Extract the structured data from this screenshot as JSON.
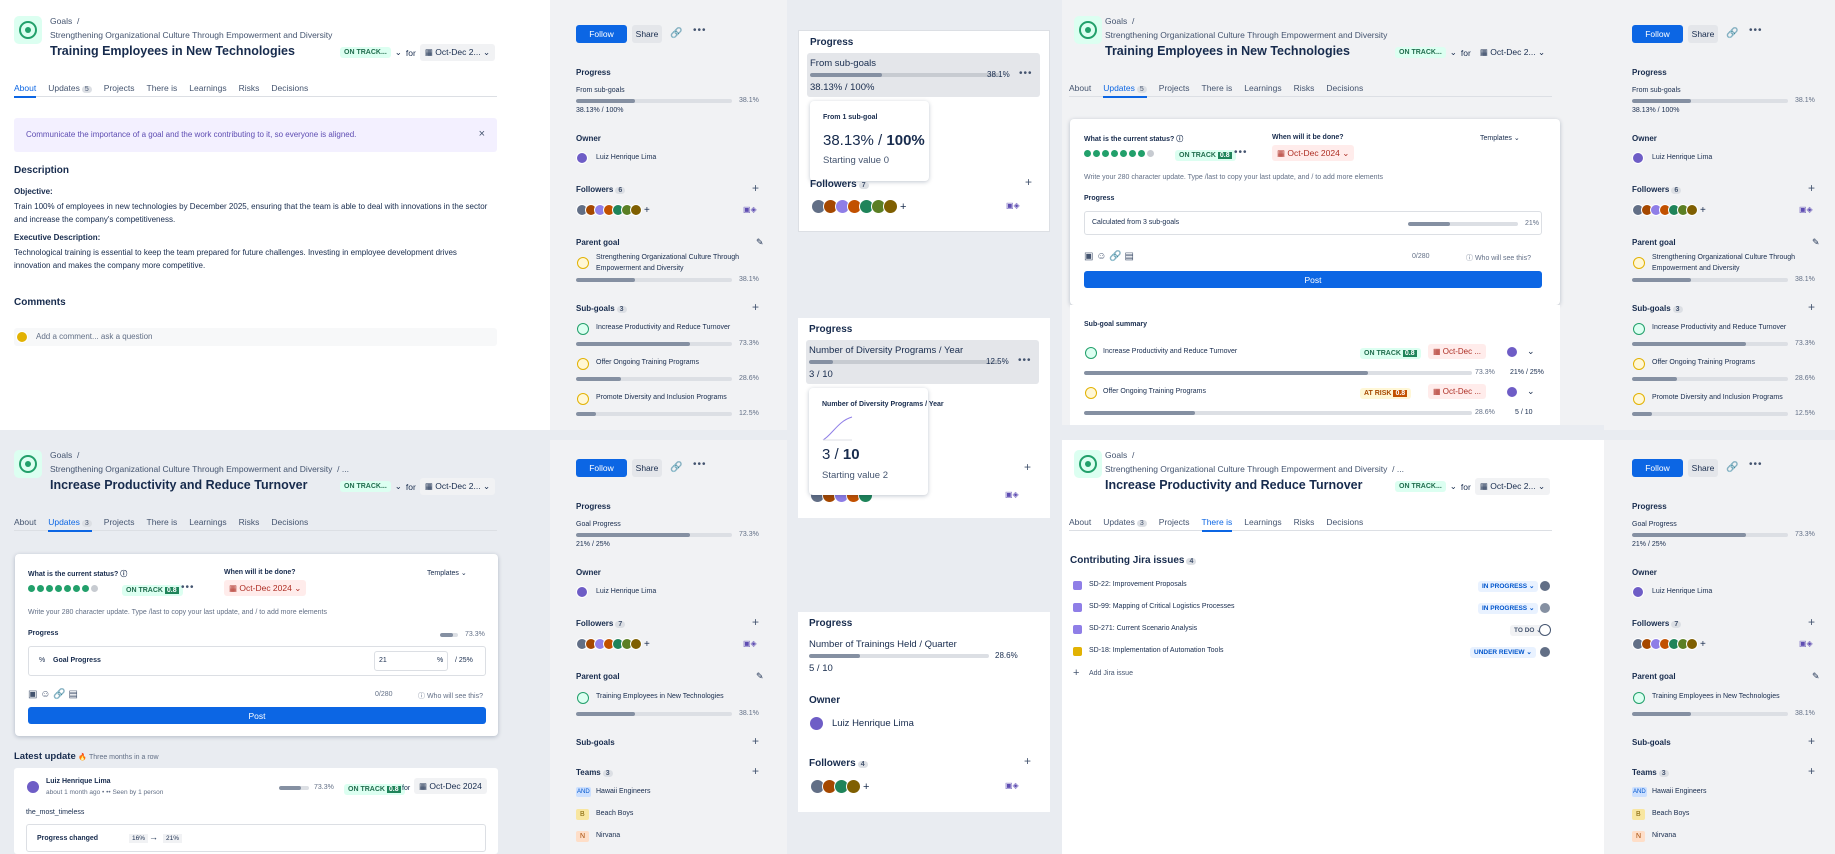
{
  "goal1": {
    "breadcrumb": "Goals",
    "parent": "Strengthening Organizational Culture Through Empowerment and Diversity",
    "title": "Training Employees in New Technologies",
    "status": "ON TRACK...",
    "for": "for",
    "date": "Oct-Dec 2..."
  },
  "goal2": {
    "breadcrumb": "Goals",
    "parent": "Strengthening Organizational Culture Through Empowerment and Diversity",
    "sep": "/  ...",
    "title": "Increase Productivity and Reduce Turnover",
    "status": "ON TRACK...",
    "for": "for",
    "date": "Oct-Dec 2..."
  },
  "tabs1": [
    {
      "label": "About"
    },
    {
      "label": "Updates",
      "count": "5"
    },
    {
      "label": "Projects"
    },
    {
      "label": "There is"
    },
    {
      "label": "Learnings"
    },
    {
      "label": "Risks"
    },
    {
      "label": "Decisions"
    }
  ],
  "tabs2": [
    {
      "label": "About"
    },
    {
      "label": "Updates",
      "count": "3"
    },
    {
      "label": "Projects"
    },
    {
      "label": "There is"
    },
    {
      "label": "Learnings"
    },
    {
      "label": "Risks"
    },
    {
      "label": "Decisions"
    }
  ],
  "about": {
    "banner": "Communicate the importance of a goal and the work contributing to it, so everyone is aligned.",
    "desc_h": "Description",
    "obj_h": "Objective:",
    "obj": "Train 100% of employees in new technologies by December 2025, ensuring that the team is able to deal with innovations in the sector and increase the company's competitiveness.",
    "exec_h": "Executive Description:",
    "exec": "Technological training is essential to keep the team prepared for future challenges. Investing in employee development drives innovation and makes the company more competitive.",
    "comments_h": "Comments",
    "comment_ph": "Add a comment... ask a question"
  },
  "side1": {
    "follow": "Follow",
    "share": "Share",
    "progress_h": "Progress",
    "prog_label": "From sub-goals",
    "prog_pct": "38.1%",
    "prog_val": "38.13% / 100%",
    "prog_frac": 0.381,
    "owner_h": "Owner",
    "owner": "Luiz Henrique Lima",
    "followers_h": "Followers",
    "followers_n": "6",
    "parent_h": "Parent goal",
    "parent": "Strengthening Organizational Culture Through Empowerment and Diversity",
    "parent_pct": "38.1%",
    "sub_h": "Sub-goals",
    "sub_n": "3",
    "subs": [
      {
        "name": "Increase Productivity and Reduce Turnover",
        "pct": "73.3%",
        "frac": 0.733,
        "color": "g"
      },
      {
        "name": "Offer Ongoing Training Programs",
        "pct": "28.6%",
        "frac": 0.286,
        "color": "y"
      },
      {
        "name": "Promote Diversity and Inclusion Programs",
        "pct": "12.5%",
        "frac": 0.125,
        "color": "y"
      }
    ]
  },
  "side2": {
    "follow": "Follow",
    "share": "Share",
    "progress_h": "Progress",
    "prog_label": "Goal Progress",
    "prog_pct": "73.3%",
    "prog_val": "21% / 25%",
    "prog_frac": 0.733,
    "owner_h": "Owner",
    "owner": "Luiz Henrique Lima",
    "followers_h": "Followers",
    "followers_n": "7",
    "parent_h": "Parent goal",
    "parent": "Training Employees in New Technologies",
    "parent_pct": "38.1%",
    "sub_h": "Sub-goals",
    "teams_h": "Teams",
    "teams_n": "3",
    "teams": [
      {
        "abbr": "AND",
        "name": "Hawaii Engineers"
      },
      {
        "abbr": "B",
        "name": "Beach Boys"
      },
      {
        "abbr": "N",
        "name": "Nirvana"
      }
    ]
  },
  "pop1": {
    "h": "Progress",
    "label": "From sub-goals",
    "pct": "38.1%",
    "val": "38.13% / 100%",
    "card_h": "From 1 sub-goal",
    "card_val": "38.13%",
    "card_sep": "/",
    "card_total": "100%",
    "card_start": "Starting value 0",
    "followers": "Followers",
    "followers_n": "7"
  },
  "pop2": {
    "h": "Progress",
    "label": "Number of Diversity Programs / Year",
    "pct": "12.5%",
    "val": "3 / 10",
    "card_h": "Number of Diversity Programs / Year",
    "card_val": "3",
    "card_sep": "/",
    "card_total": "10",
    "card_start": "Starting value 2"
  },
  "pop3": {
    "h": "Progress",
    "label": "Number of Trainings Held / Quarter",
    "pct": "28.6%",
    "val": "5 / 10",
    "owner_h": "Owner",
    "owner": "Luiz Henrique Lima",
    "followers": "Followers",
    "followers_n": "4"
  },
  "upd": {
    "q1": "What is the current status?",
    "q2": "When will it be done?",
    "templates": "Templates",
    "status": "ON TRACK",
    "score": "0.8",
    "date": "Oct-Dec 2024",
    "ph": "Write your 280 character update. Type /last to copy your last update, and / to add more elements",
    "progress": "Progress",
    "calc": "Calculated from 3 sub-goals",
    "calc_pct": "21%",
    "counter": "0/280",
    "who": "Who will see this?",
    "post": "Post",
    "summary_h": "Sub-goal summary",
    "summary": [
      {
        "name": "Increase Productivity and Reduce Turnover",
        "status": "ON TRACK",
        "score": "0.8",
        "date": "Oct-Dec ...",
        "pct": "73.3%",
        "val": "21% / 25%",
        "frac": 0.733,
        "color": "g"
      },
      {
        "name": "Offer Ongoing Training Programs",
        "status": "AT RISK",
        "score": "0.8",
        "date": "Oct-Dec ...",
        "pct": "28.6%",
        "val": "5 / 10",
        "frac": 0.286,
        "color": "y"
      }
    ]
  },
  "upd2": {
    "q1": "What is the current status?",
    "q2": "When will it be done?",
    "templates": "Templates",
    "status": "ON TRACK",
    "score": "0.8",
    "date": "Oct-Dec 2024",
    "ph": "Write your 280 character update. Type /last to copy your last update, and / to add more elements",
    "progress": "Progress",
    "prog_pct": "73.3%",
    "metric_prefix": "%",
    "metric": "Goal Progress",
    "input": "21",
    "unit": "%",
    "target": "/  25%",
    "counter": "0/280",
    "who": "Who will see this?",
    "post": "Post",
    "latest_h": "Latest update",
    "streak": "Three months in a row",
    "author": "Luiz Henrique Lima",
    "meta": "about 1 month ago • •• Seen by 1 person",
    "lu_pct": "73.3%",
    "lu_status": "ON TRACK",
    "lu_score": "0.8",
    "lu_for": "for",
    "lu_date": "Oct-Dec 2024",
    "lu_text": "the_most_timeless",
    "changed": "Progress changed",
    "from": "16%",
    "to": "21%"
  },
  "jira": {
    "h": "Contributing Jira issues",
    "n": "4",
    "issues": [
      {
        "key": "SD-22: Improvement Proposals",
        "status": "IN PROGRESS",
        "kind": "b"
      },
      {
        "key": "SD-99: Mapping of Critical Logistics Processes",
        "status": "IN PROGRESS",
        "kind": "b"
      },
      {
        "key": "SD-271: Current Scenario Analysis",
        "status": "TO DO",
        "kind": "n"
      },
      {
        "key": "SD-18: Implementation of Automation Tools",
        "status": "UNDER REVIEW",
        "kind": "b"
      }
    ],
    "add": "Add Jira issue"
  }
}
